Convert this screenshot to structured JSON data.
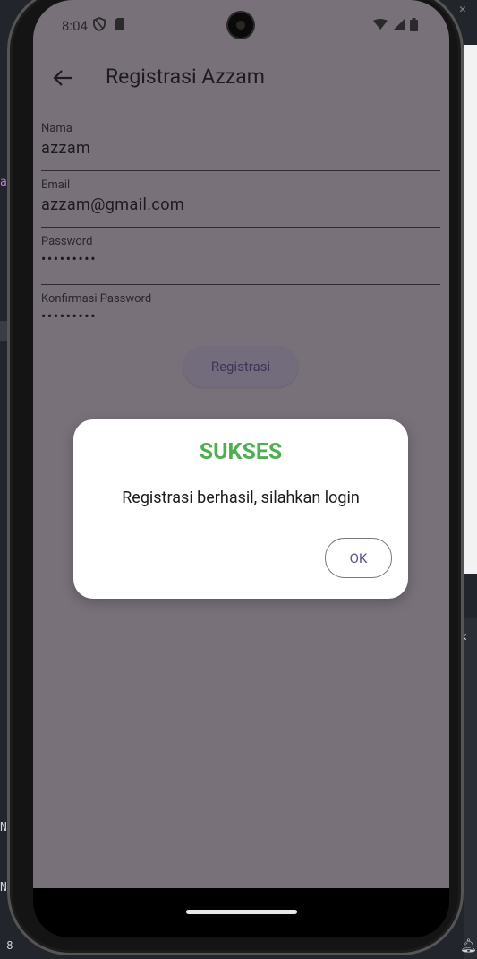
{
  "background": {
    "ide_chars": {
      "a": "a",
      "n1": "N",
      "n2": "N",
      "neg": "-8",
      "x_top": "✕",
      "x_mid": "✕"
    }
  },
  "status_bar": {
    "time": "8:04",
    "icons": [
      "shield-icon",
      "sd-card-icon",
      "wifi-icon",
      "signal-icon",
      "battery-icon"
    ]
  },
  "app_bar": {
    "title": "Registrasi Azzam",
    "back_icon": "arrow-back-icon"
  },
  "form": {
    "fields": [
      {
        "label": "Nama",
        "value": "azzam"
      },
      {
        "label": "Email",
        "value": "azzam@gmail.com"
      },
      {
        "label": "Password",
        "value": "•••••••••"
      },
      {
        "label": "Konfirmasi Password",
        "value": "•••••••••"
      }
    ],
    "submit_label": "Registrasi"
  },
  "dialog": {
    "title": "SUKSES",
    "title_color": "#4caf50",
    "message": "Registrasi berhasil, silahkan login",
    "ok_label": "OK"
  },
  "colors": {
    "scrim_background": "#78717a",
    "accent": "#5e4d92"
  }
}
